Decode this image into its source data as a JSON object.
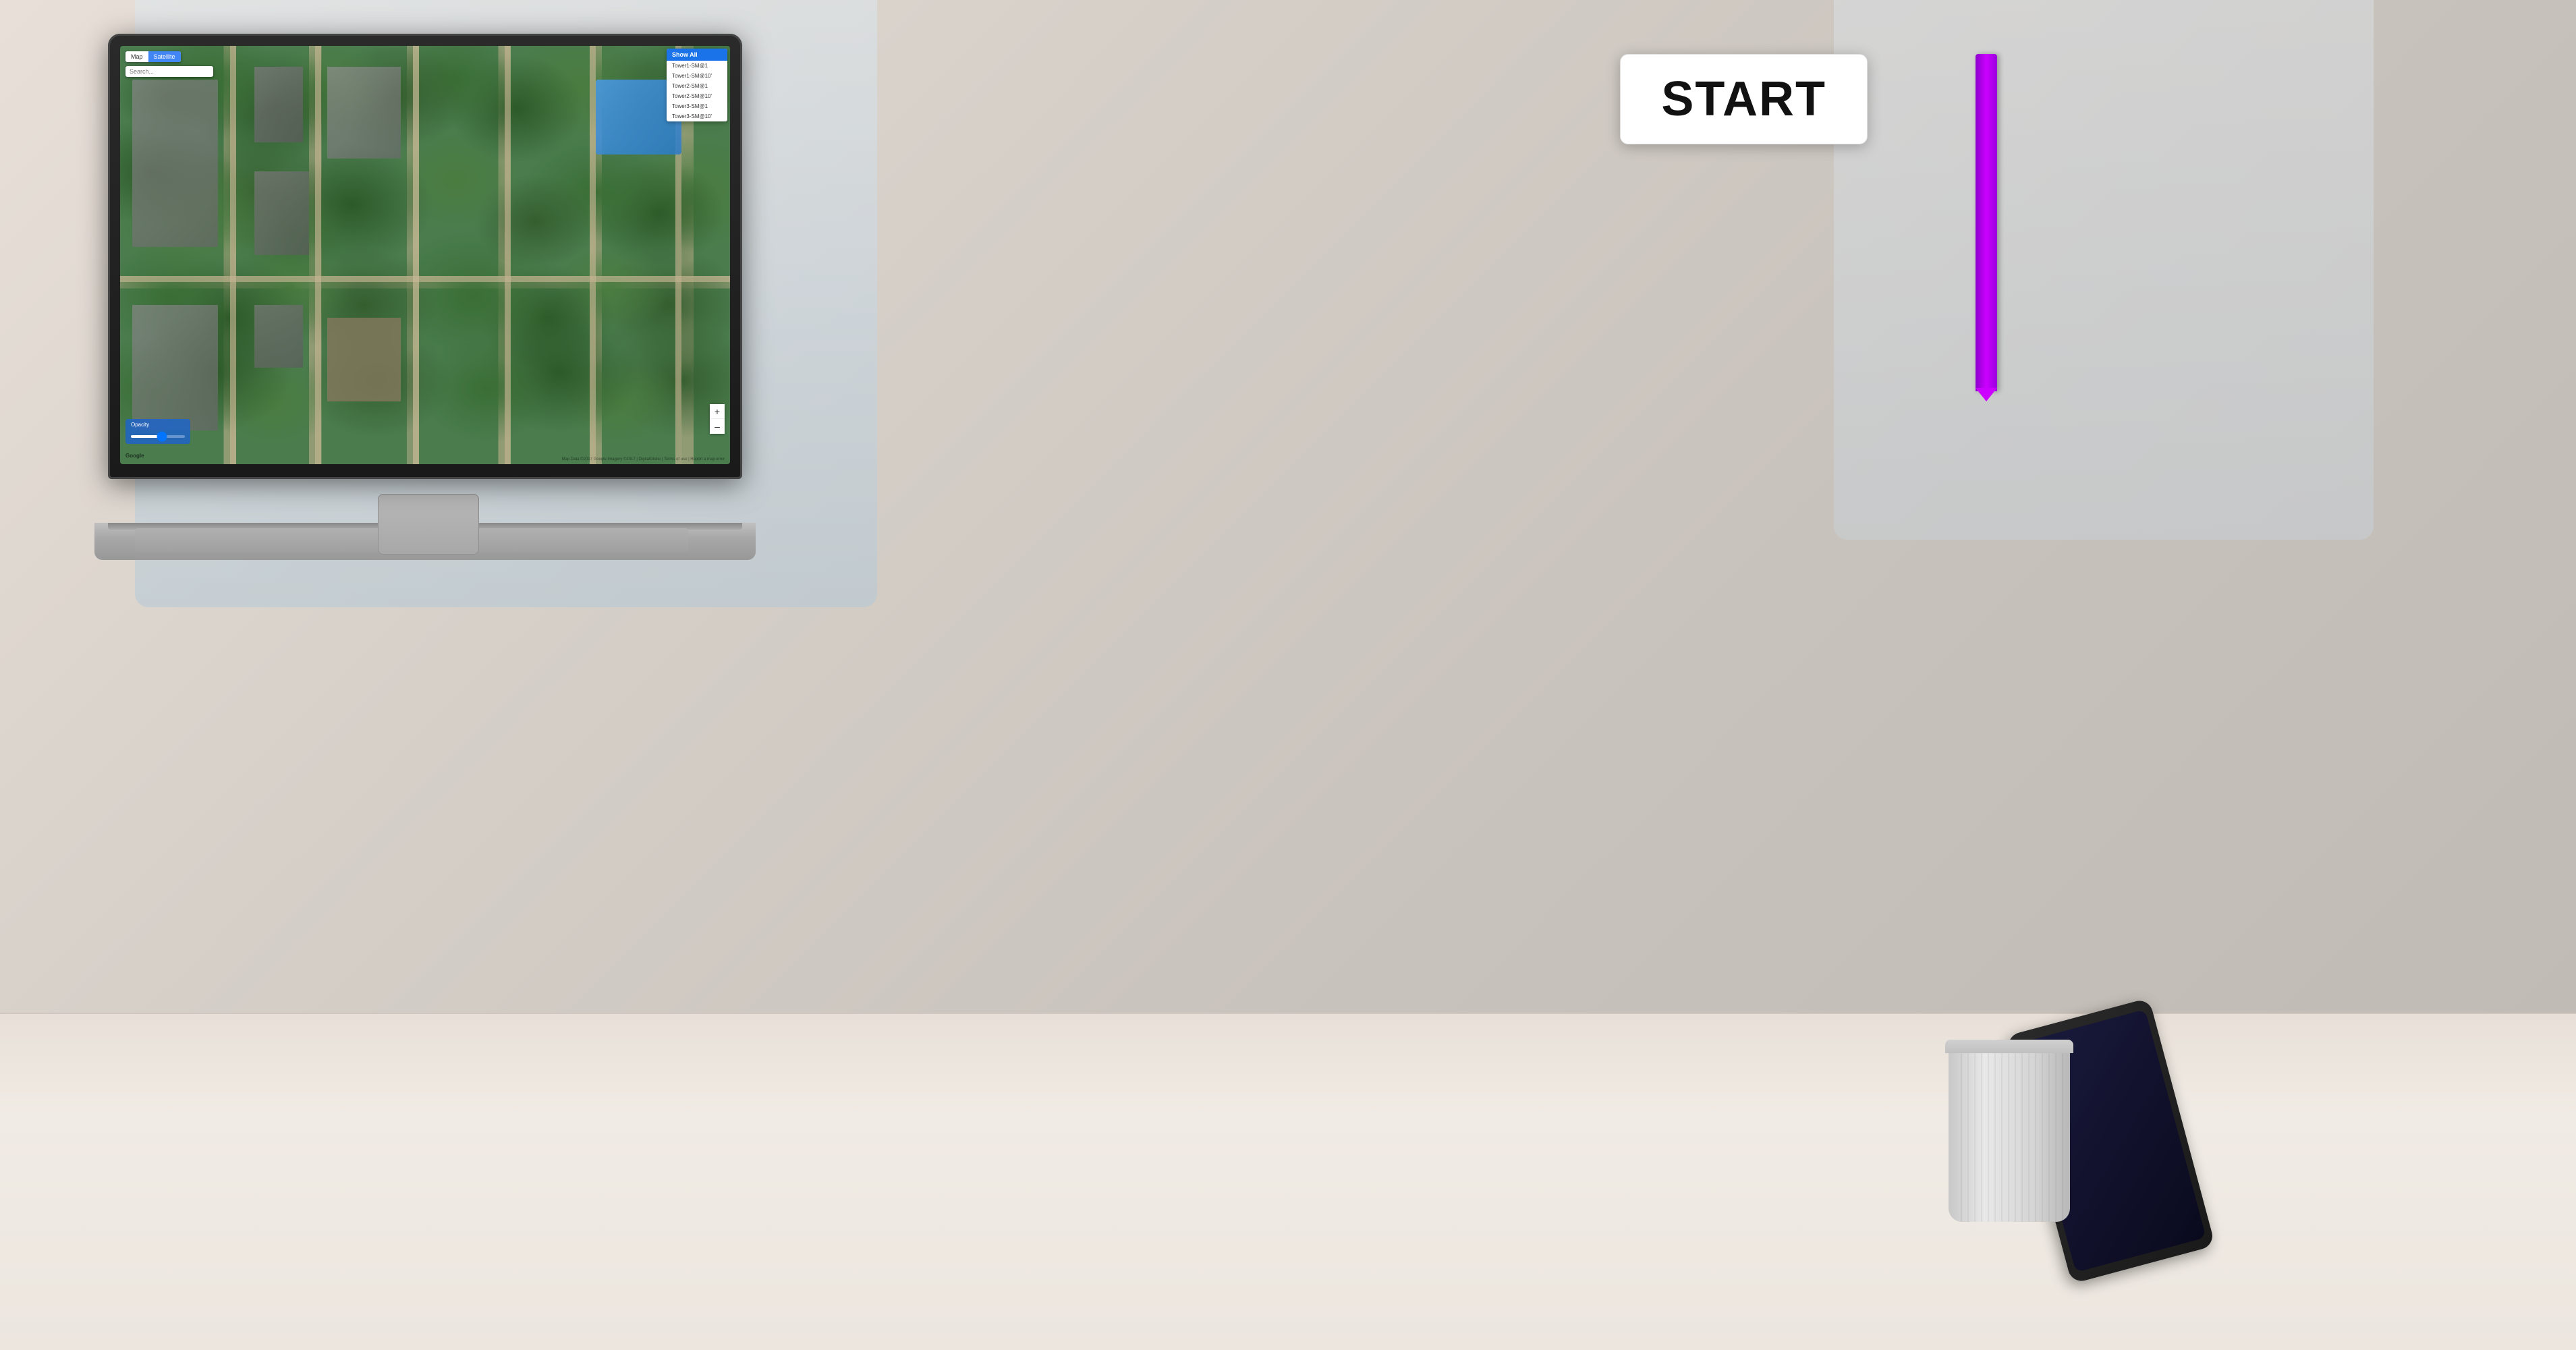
{
  "background": {
    "type": "office_blur"
  },
  "laptop": {
    "screen": {
      "map": {
        "toggle_buttons": [
          {
            "label": "Map",
            "active": false
          },
          {
            "label": "Satellite",
            "active": true
          }
        ],
        "search_placeholder": "Search...",
        "google_watermark": "Google",
        "attribution": "Map Data ©2017 Google Imagery ©2017 | DigitalGlobe | Terms of use | Report a map error",
        "opacity_label": "Opacity",
        "zoom_plus": "+",
        "zoom_minus": "–"
      },
      "layer_panel": {
        "show_all_label": "Show All",
        "items": [
          {
            "label": "Tower1-SM@1"
          },
          {
            "label": "Tower1-SM@10'"
          },
          {
            "label": "Tower2-SM@1"
          },
          {
            "label": "Tower2-SM@10'"
          },
          {
            "label": "Tower3-SM@1"
          },
          {
            "label": "Tower3-SM@10'"
          }
        ]
      }
    }
  },
  "start_button": {
    "label": "START"
  },
  "colors": {
    "active_tab": "#4285f4",
    "layer_header": "#1a73e8",
    "show_all_bg": "#1a73e8",
    "opacity_bg": "#1a73e8",
    "pen_color": "#cc00ff",
    "start_text": "#111111"
  }
}
